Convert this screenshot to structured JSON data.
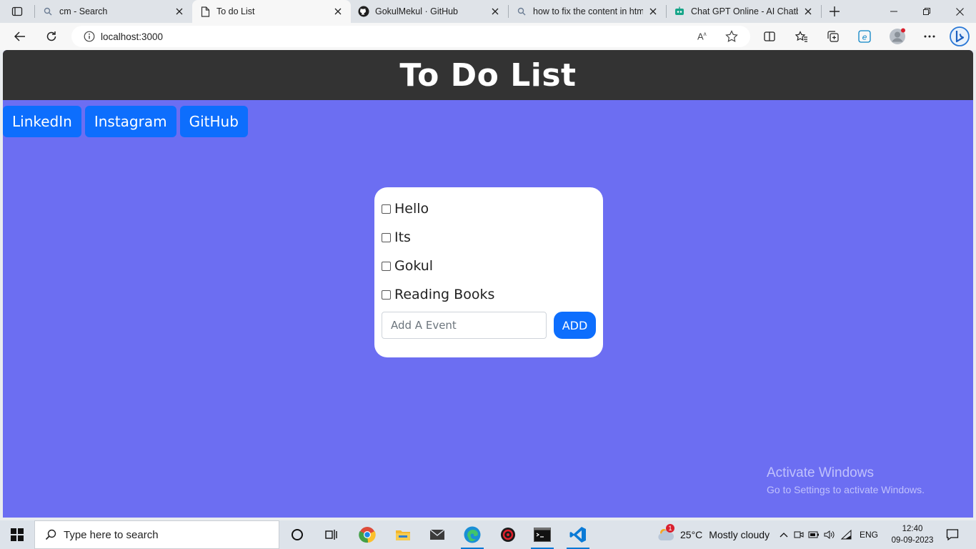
{
  "browser": {
    "tabs": [
      {
        "title": "cm - Search",
        "icon": "search-icon",
        "active": false
      },
      {
        "title": "To do List",
        "icon": "page-icon",
        "active": true
      },
      {
        "title": "GokulMekul · GitHub",
        "icon": "github-icon",
        "active": false
      },
      {
        "title": "how to fix the content in html",
        "icon": "search-icon",
        "active": false
      },
      {
        "title": "Chat GPT Online - AI Chatbot",
        "icon": "robot-icon",
        "active": false
      }
    ],
    "url": "localhost:3000"
  },
  "page": {
    "header_title": "To Do List",
    "social_links": [
      "LinkedIn",
      "Instagram",
      "GitHub"
    ],
    "todo_items": [
      {
        "label": "Hello",
        "checked": false
      },
      {
        "label": "Its",
        "checked": false
      },
      {
        "label": "Gokul",
        "checked": false
      },
      {
        "label": "Reading Books",
        "checked": false
      }
    ],
    "input_placeholder": "Add A Event",
    "add_button_label": "ADD",
    "background_color": "#6c6ef2",
    "header_color": "#333333",
    "button_color": "#0d6efd"
  },
  "watermark": {
    "line1": "Activate Windows",
    "line2": "Go to Settings to activate Windows."
  },
  "taskbar": {
    "search_placeholder": "Type here to search",
    "weather_temp": "25°C",
    "weather_desc": "Mostly cloudy",
    "weather_badge": "1",
    "language": "ENG",
    "time": "12:40",
    "date": "09-09-2023"
  }
}
